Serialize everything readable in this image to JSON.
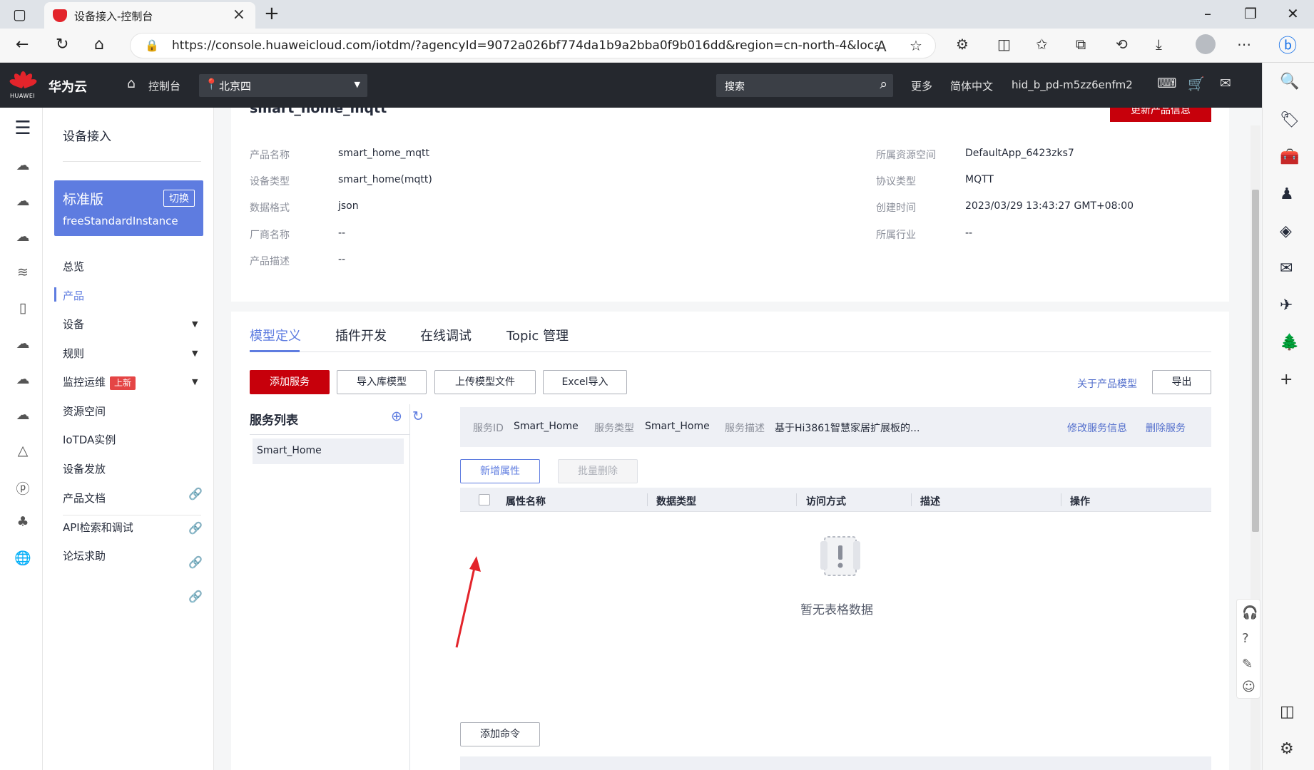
{
  "browser": {
    "tab_title": "设备接入-控制台",
    "url": "https://console.huaweicloud.com/iotdm/?agencyId=9072a026bf774da1b9a2bba0f9b016dd&region=cn-north-4&locale=zh-..."
  },
  "header": {
    "brand": "华为云",
    "logo_text": "HUAWEI",
    "console": "控制台",
    "region": "北京四",
    "search_placeholder": "搜索",
    "more": "更多",
    "language": "简体中文",
    "username": "hid_b_pd-m5zz6enfm2"
  },
  "menu": {
    "title": "设备接入",
    "instance": {
      "edition": "标准版",
      "switch": "切换",
      "name": "freeStandardInstance"
    },
    "items": [
      {
        "label": "总览"
      },
      {
        "label": "产品"
      },
      {
        "label": "设备"
      },
      {
        "label": "规则"
      },
      {
        "label": "监控运维",
        "badge": "上新"
      },
      {
        "label": "资源空间"
      },
      {
        "label": "IoTDA实例"
      },
      {
        "label": "设备发放"
      },
      {
        "label": "产品文档"
      },
      {
        "label": "API检索和调试"
      },
      {
        "label": "论坛求助"
      }
    ]
  },
  "product": {
    "name_truncated": "smart_home_mqtt",
    "update_button": "更新产品信息",
    "left": [
      {
        "label": "产品名称",
        "value": "smart_home_mqtt"
      },
      {
        "label": "设备类型",
        "value": "smart_home(mqtt)"
      },
      {
        "label": "数据格式",
        "value": "json"
      },
      {
        "label": "厂商名称",
        "value": "--"
      },
      {
        "label": "产品描述",
        "value": "--"
      }
    ],
    "right": [
      {
        "label": "所属资源空间",
        "value": "DefaultApp_6423zks7"
      },
      {
        "label": "协议类型",
        "value": "MQTT"
      },
      {
        "label": "创建时间",
        "value": "2023/03/29 13:43:27 GMT+08:00"
      },
      {
        "label": "所属行业",
        "value": "--"
      }
    ]
  },
  "tabs": [
    "模型定义",
    "插件开发",
    "在线调试",
    "Topic 管理"
  ],
  "toolbar": {
    "add_service": "添加服务",
    "import_library": "导入库模型",
    "upload_model": "上传模型文件",
    "excel_import": "Excel导入",
    "about_model": "关于产品模型",
    "export": "导出"
  },
  "service_list": {
    "title": "服务列表",
    "items": [
      "Smart_Home"
    ]
  },
  "service_info": {
    "id_label": "服务ID",
    "id": "Smart_Home",
    "type_label": "服务类型",
    "type": "Smart_Home",
    "desc_label": "服务描述",
    "desc": "基于Hi3861智慧家居扩展板的...",
    "edit": "修改服务信息",
    "delete": "删除服务"
  },
  "properties": {
    "add": "新增属性",
    "batch_delete": "批量删除",
    "columns": [
      "属性名称",
      "数据类型",
      "访问方式",
      "描述",
      "操作"
    ],
    "empty": "暂无表格数据"
  },
  "commands": {
    "add": "添加命令"
  },
  "colors": {
    "accent": "#5e7ce0",
    "brand_red": "#c7000b",
    "topbar": "#25282e"
  }
}
